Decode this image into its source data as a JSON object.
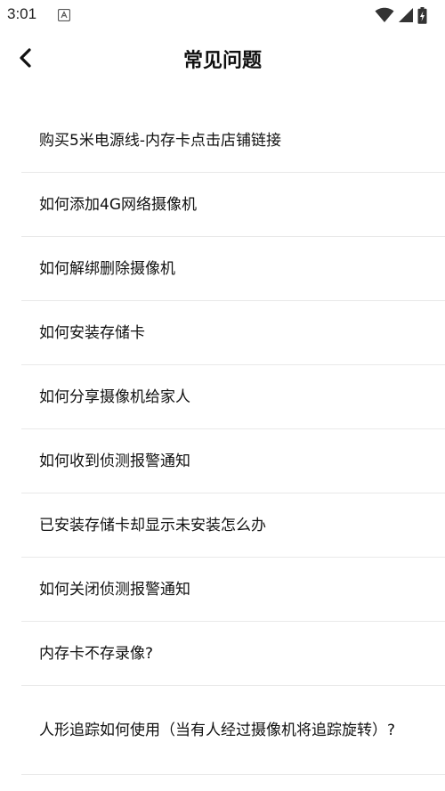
{
  "status_bar": {
    "time": "3:01",
    "icons": [
      "app-notification-icon",
      "wifi-icon",
      "signal-icon",
      "battery-icon"
    ]
  },
  "header": {
    "back_icon": "chevron-left-icon",
    "title": "常见问题"
  },
  "faq": {
    "items": [
      {
        "label": "购买5米电源线-内存卡点击店铺链接"
      },
      {
        "label": "如何添加4G网络摄像机"
      },
      {
        "label": "如何解绑删除摄像机"
      },
      {
        "label": "如何安装存储卡"
      },
      {
        "label": "如何分享摄像机给家人"
      },
      {
        "label": "如何收到侦测报警通知"
      },
      {
        "label": "已安装存储卡却显示未安装怎么办"
      },
      {
        "label": "如何关闭侦测报警通知"
      },
      {
        "label": "内存卡不存录像?"
      },
      {
        "label": "人形追踪如何使用（当有人经过摄像机将追踪旋转）?"
      }
    ]
  },
  "colors": {
    "text": "#111111",
    "divider": "#e9e9e9",
    "background": "#ffffff"
  }
}
